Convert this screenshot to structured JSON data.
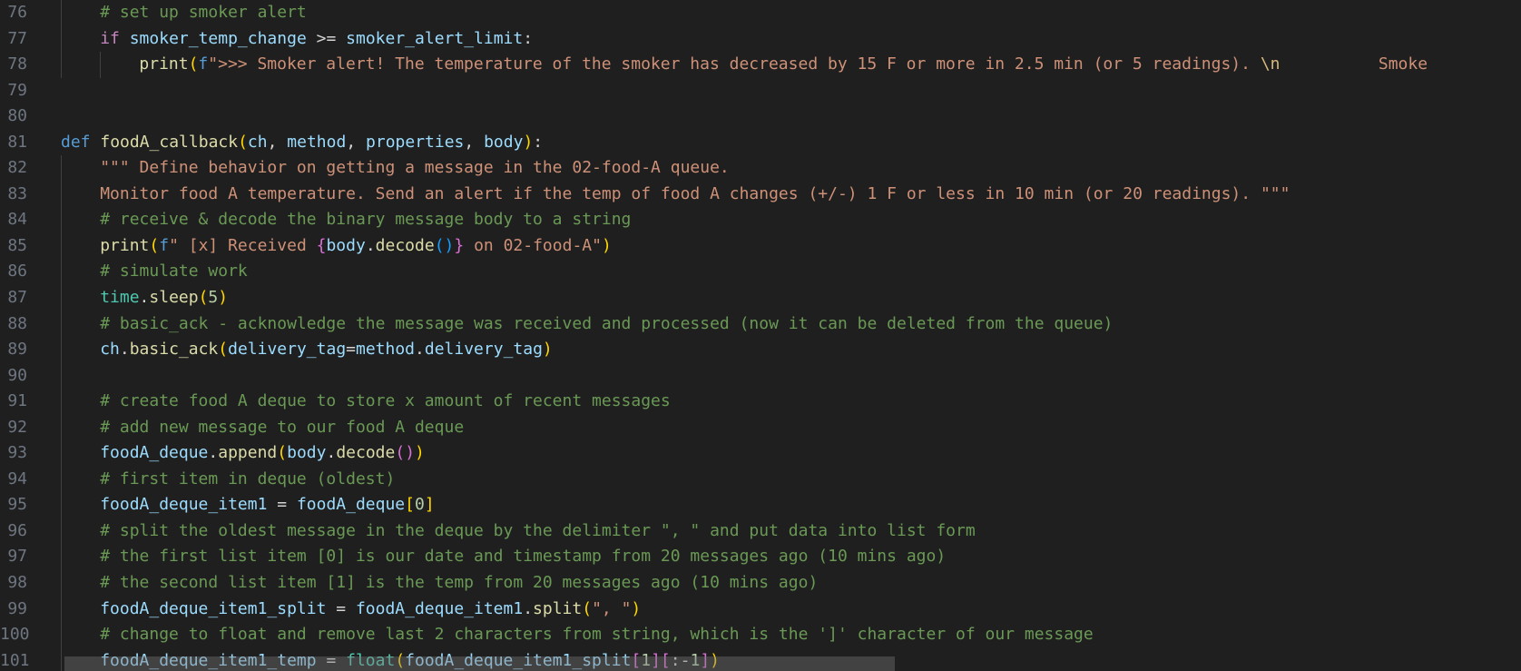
{
  "editor": {
    "lines": [
      {
        "n": "76",
        "indent": 1,
        "tokens": [
          [
            "comment",
            "# set up smoker alert"
          ]
        ]
      },
      {
        "n": "77",
        "indent": 1,
        "tokens": [
          [
            "keyword",
            "if"
          ],
          [
            "default",
            " "
          ],
          [
            "var",
            "smoker_temp_change"
          ],
          [
            "default",
            " >= "
          ],
          [
            "var",
            "smoker_alert_limit"
          ],
          [
            "default",
            ":"
          ]
        ]
      },
      {
        "n": "78",
        "indent": 2,
        "tokens": [
          [
            "func",
            "print"
          ],
          [
            "p1",
            "("
          ],
          [
            "def",
            "f"
          ],
          [
            "string",
            "\">>> Smoker alert! The temperature of the smoker has decreased by 15 F or more in 2.5 min (or 5 readings). "
          ],
          [
            "escape",
            "\\n"
          ],
          [
            "string",
            "          Smoke"
          ]
        ]
      },
      {
        "n": "79",
        "indent": 0,
        "tokens": []
      },
      {
        "n": "80",
        "indent": 0,
        "tokens": []
      },
      {
        "n": "81",
        "indent": 0,
        "tokens": [
          [
            "def",
            "def"
          ],
          [
            "default",
            " "
          ],
          [
            "func",
            "foodA_callback"
          ],
          [
            "p1",
            "("
          ],
          [
            "param",
            "ch"
          ],
          [
            "default",
            ", "
          ],
          [
            "param",
            "method"
          ],
          [
            "default",
            ", "
          ],
          [
            "param",
            "properties"
          ],
          [
            "default",
            ", "
          ],
          [
            "param",
            "body"
          ],
          [
            "p1",
            ")"
          ],
          [
            "default",
            ":"
          ]
        ]
      },
      {
        "n": "82",
        "indent": 1,
        "tokens": [
          [
            "string",
            "\"\"\" Define behavior on getting a message in the 02-food-A queue."
          ]
        ]
      },
      {
        "n": "83",
        "indent": 1,
        "tokens": [
          [
            "string",
            "Monitor food A temperature. Send an alert if the temp of food A changes (+/-) 1 F or less in 10 min (or 20 readings). \"\"\""
          ]
        ]
      },
      {
        "n": "84",
        "indent": 1,
        "tokens": [
          [
            "comment",
            "# receive & decode the binary message body to a string"
          ]
        ]
      },
      {
        "n": "85",
        "indent": 1,
        "tokens": [
          [
            "func",
            "print"
          ],
          [
            "p1",
            "("
          ],
          [
            "def",
            "f"
          ],
          [
            "string",
            "\" [x] Received "
          ],
          [
            "p2",
            "{"
          ],
          [
            "var",
            "body"
          ],
          [
            "default",
            "."
          ],
          [
            "func",
            "decode"
          ],
          [
            "p3",
            "()"
          ],
          [
            "p2",
            "}"
          ],
          [
            "string",
            " on 02-food-A\""
          ],
          [
            "p1",
            ")"
          ]
        ]
      },
      {
        "n": "86",
        "indent": 1,
        "tokens": [
          [
            "comment",
            "# simulate work"
          ]
        ]
      },
      {
        "n": "87",
        "indent": 1,
        "tokens": [
          [
            "class",
            "time"
          ],
          [
            "default",
            "."
          ],
          [
            "func",
            "sleep"
          ],
          [
            "p1",
            "("
          ],
          [
            "number",
            "5"
          ],
          [
            "p1",
            ")"
          ]
        ]
      },
      {
        "n": "88",
        "indent": 1,
        "tokens": [
          [
            "comment",
            "# basic_ack - acknowledge the message was received and processed (now it can be deleted from the queue)"
          ]
        ]
      },
      {
        "n": "89",
        "indent": 1,
        "tokens": [
          [
            "var",
            "ch"
          ],
          [
            "default",
            "."
          ],
          [
            "func",
            "basic_ack"
          ],
          [
            "p1",
            "("
          ],
          [
            "param",
            "delivery_tag"
          ],
          [
            "default",
            "="
          ],
          [
            "var",
            "method"
          ],
          [
            "default",
            "."
          ],
          [
            "var",
            "delivery_tag"
          ],
          [
            "p1",
            ")"
          ]
        ]
      },
      {
        "n": "90",
        "indent": 1,
        "tokens": []
      },
      {
        "n": "91",
        "indent": 1,
        "tokens": [
          [
            "comment",
            "# create food A deque to store x amount of recent messages"
          ]
        ]
      },
      {
        "n": "92",
        "indent": 1,
        "tokens": [
          [
            "comment",
            "# add new message to our food A deque"
          ]
        ]
      },
      {
        "n": "93",
        "indent": 1,
        "tokens": [
          [
            "var",
            "foodA_deque"
          ],
          [
            "default",
            "."
          ],
          [
            "func",
            "append"
          ],
          [
            "p1",
            "("
          ],
          [
            "var",
            "body"
          ],
          [
            "default",
            "."
          ],
          [
            "func",
            "decode"
          ],
          [
            "p2",
            "()"
          ],
          [
            "p1",
            ")"
          ]
        ]
      },
      {
        "n": "94",
        "indent": 1,
        "tokens": [
          [
            "comment",
            "# first item in deque (oldest)"
          ]
        ]
      },
      {
        "n": "95",
        "indent": 1,
        "tokens": [
          [
            "var",
            "foodA_deque_item1"
          ],
          [
            "default",
            " = "
          ],
          [
            "var",
            "foodA_deque"
          ],
          [
            "p1",
            "["
          ],
          [
            "number",
            "0"
          ],
          [
            "p1",
            "]"
          ]
        ]
      },
      {
        "n": "96",
        "indent": 1,
        "tokens": [
          [
            "comment",
            "# split the oldest message in the deque by the delimiter \", \" and put data into list form"
          ]
        ]
      },
      {
        "n": "97",
        "indent": 1,
        "tokens": [
          [
            "comment",
            "# the first list item [0] is our date and timestamp from 20 messages ago (10 mins ago)"
          ]
        ]
      },
      {
        "n": "98",
        "indent": 1,
        "tokens": [
          [
            "comment",
            "# the second list item [1] is the temp from 20 messages ago (10 mins ago)"
          ]
        ]
      },
      {
        "n": "99",
        "indent": 1,
        "tokens": [
          [
            "var",
            "foodA_deque_item1_split"
          ],
          [
            "default",
            " = "
          ],
          [
            "var",
            "foodA_deque_item1"
          ],
          [
            "default",
            "."
          ],
          [
            "func",
            "split"
          ],
          [
            "p1",
            "("
          ],
          [
            "string",
            "\", \""
          ],
          [
            "p1",
            ")"
          ]
        ]
      },
      {
        "n": "100",
        "indent": 1,
        "tokens": [
          [
            "comment",
            "# change to float and remove last 2 characters from string, which is the ']' character of our message"
          ]
        ]
      },
      {
        "n": "101",
        "indent": 1,
        "tokens": [
          [
            "var",
            "foodA_deque_item1_temp"
          ],
          [
            "default",
            " = "
          ],
          [
            "builtin",
            "float"
          ],
          [
            "p1",
            "("
          ],
          [
            "var",
            "foodA_deque_item1_split"
          ],
          [
            "p2",
            "["
          ],
          [
            "number",
            "1"
          ],
          [
            "p2",
            "]["
          ],
          [
            "default",
            ":-"
          ],
          [
            "number",
            "1"
          ],
          [
            "p2",
            "]"
          ],
          [
            "p1",
            ")"
          ]
        ]
      }
    ]
  }
}
